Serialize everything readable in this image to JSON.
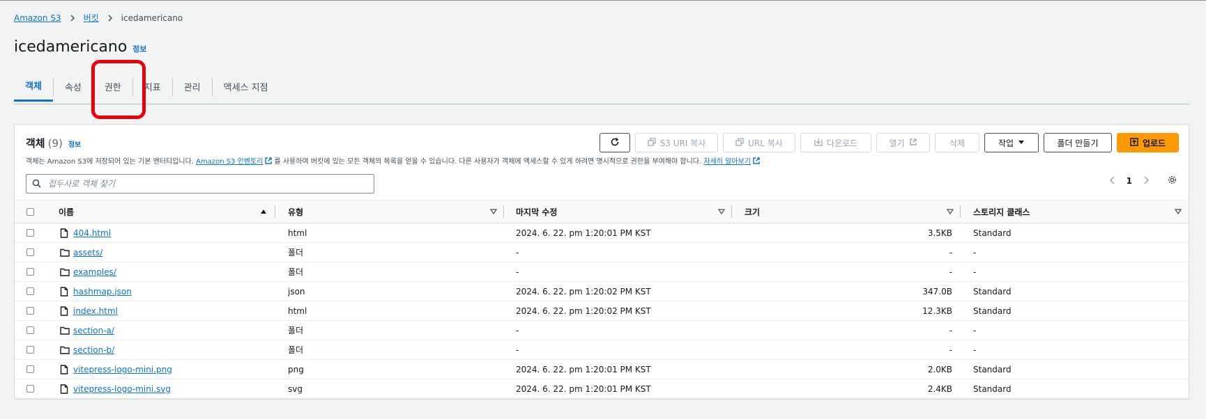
{
  "breadcrumb": {
    "root": "Amazon S3",
    "buckets": "버킷",
    "current": "icedamericano"
  },
  "page": {
    "title": "icedamericano",
    "info": "정보"
  },
  "tabs": [
    "객체",
    "속성",
    "권한",
    "지표",
    "관리",
    "액세스 지점"
  ],
  "active_tab": "객체",
  "panel": {
    "title": "객체",
    "count": "(9)",
    "info": "정보",
    "desc_prefix": "객체는 Amazon S3에 저장되어 있는 기본 엔터티입니다.",
    "desc_link1": "Amazon S3 인벤토리",
    "desc_middle": "를 사용하여 버킷에 있는 모든 객체의 목록을 얻을 수 있습니다. 다른 사용자가 객체에 액세스할 수 있게 하려면 명시적으로 권한을 부여해야 합니다.",
    "desc_link2": "자세히 알아보기"
  },
  "toolbar": {
    "copy_s3_uri": "S3 URI 복사",
    "copy_url": "URL 복사",
    "download": "다운로드",
    "open": "열기",
    "delete": "삭제",
    "actions": "작업",
    "create_folder": "폴더 만들기",
    "upload": "업로드"
  },
  "search": {
    "placeholder": "접두사로 객체 찾기"
  },
  "pagination": {
    "page": "1"
  },
  "table": {
    "headers": {
      "name": "이름",
      "type": "유형",
      "modified": "마지막 수정",
      "size": "크기",
      "storage": "스토리지 클래스"
    },
    "rows": [
      {
        "name": "404.html",
        "kind": "file",
        "type": "html",
        "modified": "2024. 6. 22. pm 1:20:01 PM KST",
        "size": "3.5KB",
        "storage": "Standard"
      },
      {
        "name": "assets/",
        "kind": "folder",
        "type": "폴더",
        "modified": "-",
        "size": "-",
        "storage": "-"
      },
      {
        "name": "examples/",
        "kind": "folder",
        "type": "폴더",
        "modified": "-",
        "size": "-",
        "storage": "-"
      },
      {
        "name": "hashmap.json",
        "kind": "file",
        "type": "json",
        "modified": "2024. 6. 22. pm 1:20:02 PM KST",
        "size": "347.0B",
        "storage": "Standard"
      },
      {
        "name": "index.html",
        "kind": "file",
        "type": "html",
        "modified": "2024. 6. 22. pm 1:20:02 PM KST",
        "size": "12.3KB",
        "storage": "Standard"
      },
      {
        "name": "section-a/",
        "kind": "folder",
        "type": "폴더",
        "modified": "-",
        "size": "-",
        "storage": "-"
      },
      {
        "name": "section-b/",
        "kind": "folder",
        "type": "폴더",
        "modified": "-",
        "size": "-",
        "storage": "-"
      },
      {
        "name": "vitepress-logo-mini.png",
        "kind": "file",
        "type": "png",
        "modified": "2024. 6. 22. pm 1:20:01 PM KST",
        "size": "2.0KB",
        "storage": "Standard"
      },
      {
        "name": "vitepress-logo-mini.svg",
        "kind": "file",
        "type": "svg",
        "modified": "2024. 6. 22. pm 1:20:01 PM KST",
        "size": "2.4KB",
        "storage": "Standard"
      }
    ]
  },
  "colors": {
    "link": "#0972d3",
    "primary": "#ff9900",
    "highlight": "#e8000b"
  }
}
